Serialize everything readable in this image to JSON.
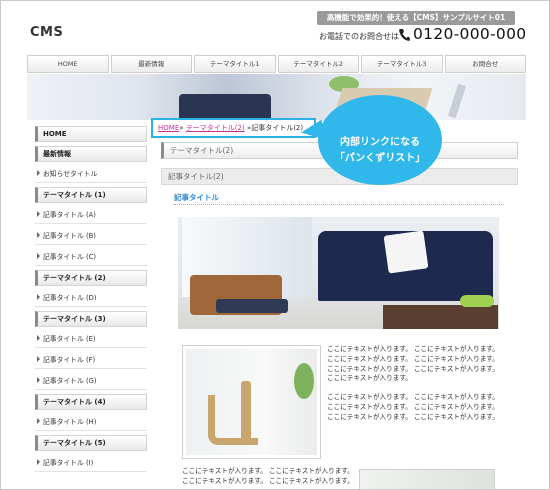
{
  "header": {
    "banner": "高機能で効果的！使える【CMS】サンプルサイト01",
    "logo": "CMS",
    "contact_label": "お電話でのお問合せは",
    "phone_number": "0120-000-000"
  },
  "nav": {
    "items": [
      "HOME",
      "最新情報",
      "テーマタイトル1",
      "テーマタイトル2",
      "テーマタイトル3",
      "お問合せ"
    ]
  },
  "sidebar": {
    "home": "HOME",
    "news": "最新情報",
    "news_item": "お知らせタイトル",
    "theme1": "テーマタイトル (1)",
    "t1_a": "記事タイトル (A)",
    "t1_b": "記事タイトル (B)",
    "t1_c": "記事タイトル (C)",
    "theme2": "テーマタイトル (2)",
    "t2_d": "記事タイトル (D)",
    "theme3": "テーマタイトル (3)",
    "t3_e": "記事タイトル (E)",
    "t3_f": "記事タイトル (F)",
    "t3_g": "記事タイトル (G)",
    "theme4": "テーマタイトル (4)",
    "t4_h": "記事タイトル (H)",
    "theme5": "テーマタイトル (5)",
    "t5_i": "記事タイトル (I)"
  },
  "breadcrumb": {
    "home": "HOME",
    "sep1": "» ",
    "theme": "テーマタイトル(2)",
    "sep2": " »",
    "current": "記事タイトル(2)"
  },
  "main": {
    "section_title": "テーマタイトル(2)",
    "sub_title": "記事タイトル(2)",
    "article_title": "記事タイトル",
    "para1": "ここにテキストが入ります。 ここにテキストが入ります。 ここにテキストが入ります。 ここにテキストが入ります。 ここにテキストが入ります。 ここにテキストが入ります。 ここにテキストが入ります。",
    "para2": "ここにテキストが入ります。 ここにテキストが入ります。 ここにテキストが入ります。 ここにテキストが入ります。 ここにテキストが入ります。 ここにテキストが入ります。",
    "bottom_text": "ここにテキストが入ります。 ここにテキストが入ります。 ここにテキストが入ります。 ここにテキストが入ります。"
  },
  "callout": {
    "line1": "内部リンクになる",
    "line2": "「パンくずリスト」",
    "color": "#31b8ea"
  }
}
